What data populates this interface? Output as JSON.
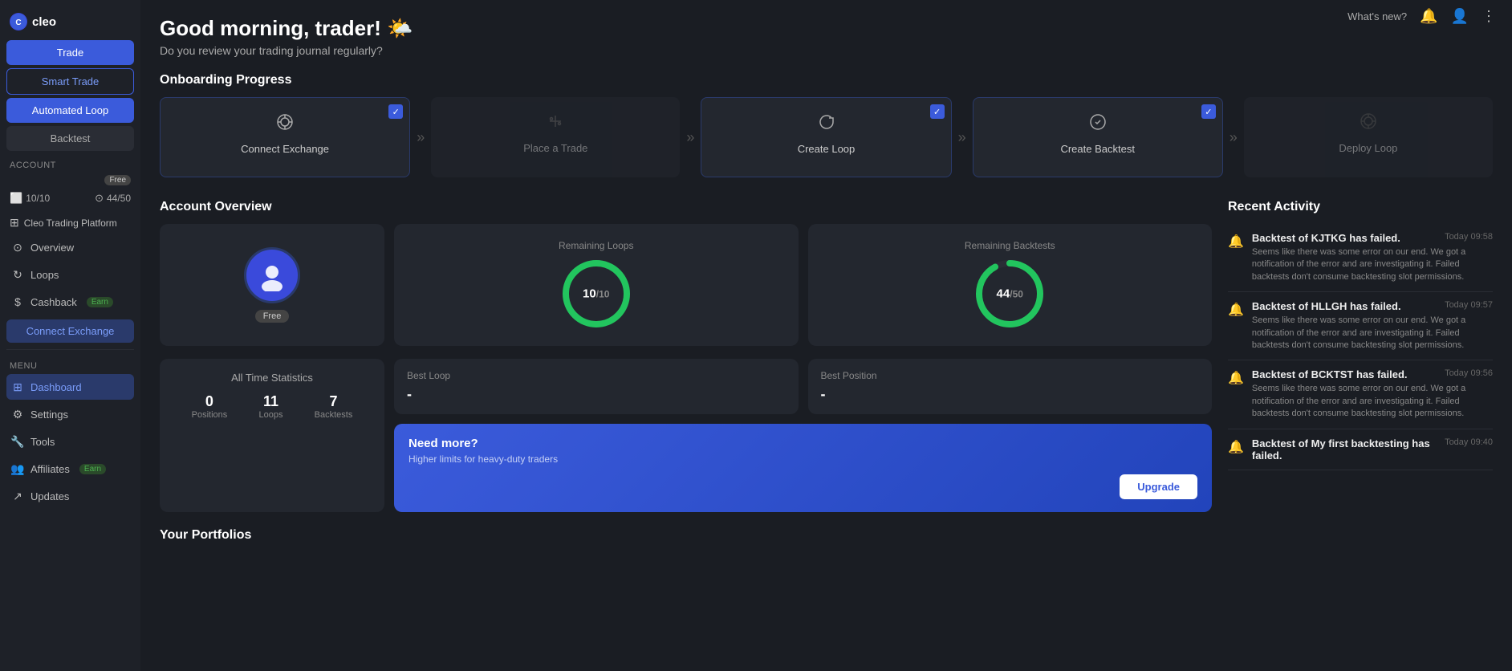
{
  "logo": {
    "text": "cleo",
    "circle_text": "C"
  },
  "sidebar": {
    "buttons": {
      "trade": "Trade",
      "smart_trade": "Smart Trade",
      "automated_loop": "Automated Loop",
      "backtest": "Backtest"
    },
    "account_label": "Account",
    "free_badge": "Free",
    "stats": {
      "loops": "10/10",
      "backtests": "44/50"
    },
    "platform": "Cleo Trading Platform",
    "menu_items": [
      {
        "id": "overview",
        "label": "Overview",
        "icon": "⊙"
      },
      {
        "id": "loops",
        "label": "Loops",
        "icon": "⬜"
      },
      {
        "id": "cashback",
        "label": "Cashback",
        "badge": "Earn"
      },
      {
        "id": "connect_exchange",
        "label": "Connect Exchange"
      }
    ],
    "menu_label": "Menu",
    "nav_items": [
      {
        "id": "dashboard",
        "label": "Dashboard",
        "icon": "⊞",
        "active": true
      },
      {
        "id": "settings",
        "label": "Settings",
        "icon": "⚙"
      },
      {
        "id": "tools",
        "label": "Tools",
        "icon": "🔧"
      },
      {
        "id": "affiliates",
        "label": "Affiliates",
        "badge": "Earn",
        "icon": "👥"
      },
      {
        "id": "updates",
        "label": "Updates",
        "icon": "↗"
      }
    ]
  },
  "topbar": {
    "whats_new": "What's new?",
    "bell_icon": "🔔",
    "user_icon": "👤",
    "menu_icon": "⋮"
  },
  "greeting": {
    "title": "Good morning, trader! 🌤️",
    "subtitle": "Do you review your trading journal regularly?"
  },
  "onboarding": {
    "title": "Onboarding Progress",
    "steps": [
      {
        "id": "connect-exchange",
        "label": "Connect Exchange",
        "icon": "((·))",
        "completed": true
      },
      {
        "id": "place-trade",
        "label": "Place a Trade",
        "icon": "⚡",
        "completed": false
      },
      {
        "id": "create-loop",
        "label": "Create Loop",
        "icon": "↻",
        "completed": true
      },
      {
        "id": "create-backtest",
        "label": "Create Backtest",
        "icon": "⊙",
        "completed": true
      },
      {
        "id": "deploy-loop",
        "label": "Deploy Loop",
        "icon": "((·))",
        "completed": false
      }
    ]
  },
  "account_overview": {
    "title": "Account Overview",
    "plan": "Free",
    "remaining_loops": {
      "label": "Remaining Loops",
      "current": 10,
      "total": 10,
      "color": "#22c55e"
    },
    "remaining_backtests": {
      "label": "Remaining Backtests",
      "current": 44,
      "total": 50,
      "color": "#22c55e"
    },
    "all_time": {
      "title": "All Time Statistics",
      "positions_label": "Positions",
      "positions_val": "0",
      "loops_label": "Loops",
      "loops_val": "11",
      "backtests_label": "Backtests",
      "backtests_val": "7"
    },
    "best_loop": {
      "label": "Best Loop",
      "value": "-"
    },
    "best_position": {
      "label": "Best Position",
      "value": "-"
    },
    "need_more": {
      "title": "Need more?",
      "subtitle": "Higher limits for heavy-duty traders",
      "upgrade_btn": "Upgrade"
    }
  },
  "recent_activity": {
    "title": "Recent Activity",
    "items": [
      {
        "id": "activity-1",
        "title": "Backtest of KJTKG has failed.",
        "description": "Seems like there was some error on our end. We got a notification of the error and are investigating it. Failed backtests don't consume backtesting slot permissions.",
        "time": "Today 09:58"
      },
      {
        "id": "activity-2",
        "title": "Backtest of HLLGH has failed.",
        "description": "Seems like there was some error on our end. We got a notification of the error and are investigating it. Failed backtests don't consume backtesting slot permissions.",
        "time": "Today 09:57"
      },
      {
        "id": "activity-3",
        "title": "Backtest of BCKTST has failed.",
        "description": "Seems like there was some error on our end. We got a notification of the error and are investigating it. Failed backtests don't consume backtesting slot permissions.",
        "time": "Today 09:56"
      },
      {
        "id": "activity-4",
        "title": "Backtest of My first backtesting has failed.",
        "description": "",
        "time": "Today 09:40"
      }
    ]
  },
  "portfolios": {
    "title": "Your Portfolios"
  }
}
